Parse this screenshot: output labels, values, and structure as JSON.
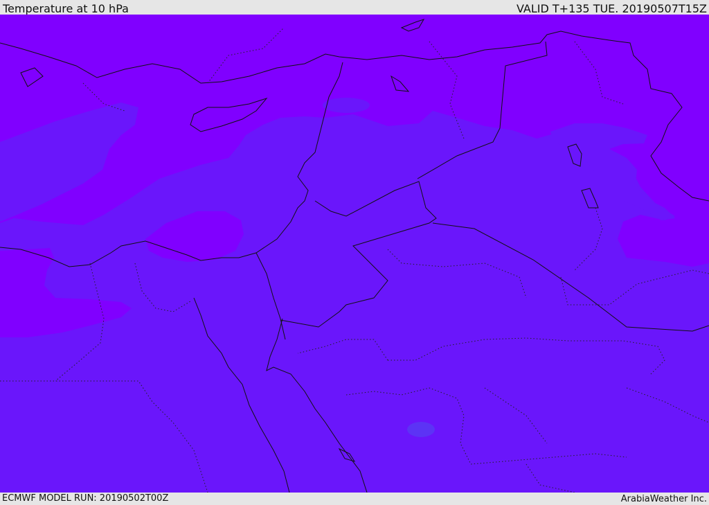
{
  "header": {
    "title": "Temperature at 10 hPa",
    "valid": "VALID T+135 TUE. 20190507T15Z"
  },
  "footer": {
    "model_run": "ECMWF MODEL RUN: 20190502T00Z",
    "credit": "ArabiaWeather Inc."
  },
  "map": {
    "colors": {
      "warm_band": "#8000ff",
      "mid_band": "#6b15fc",
      "cool_spot": "#5c33f5",
      "border": "#111111"
    }
  }
}
